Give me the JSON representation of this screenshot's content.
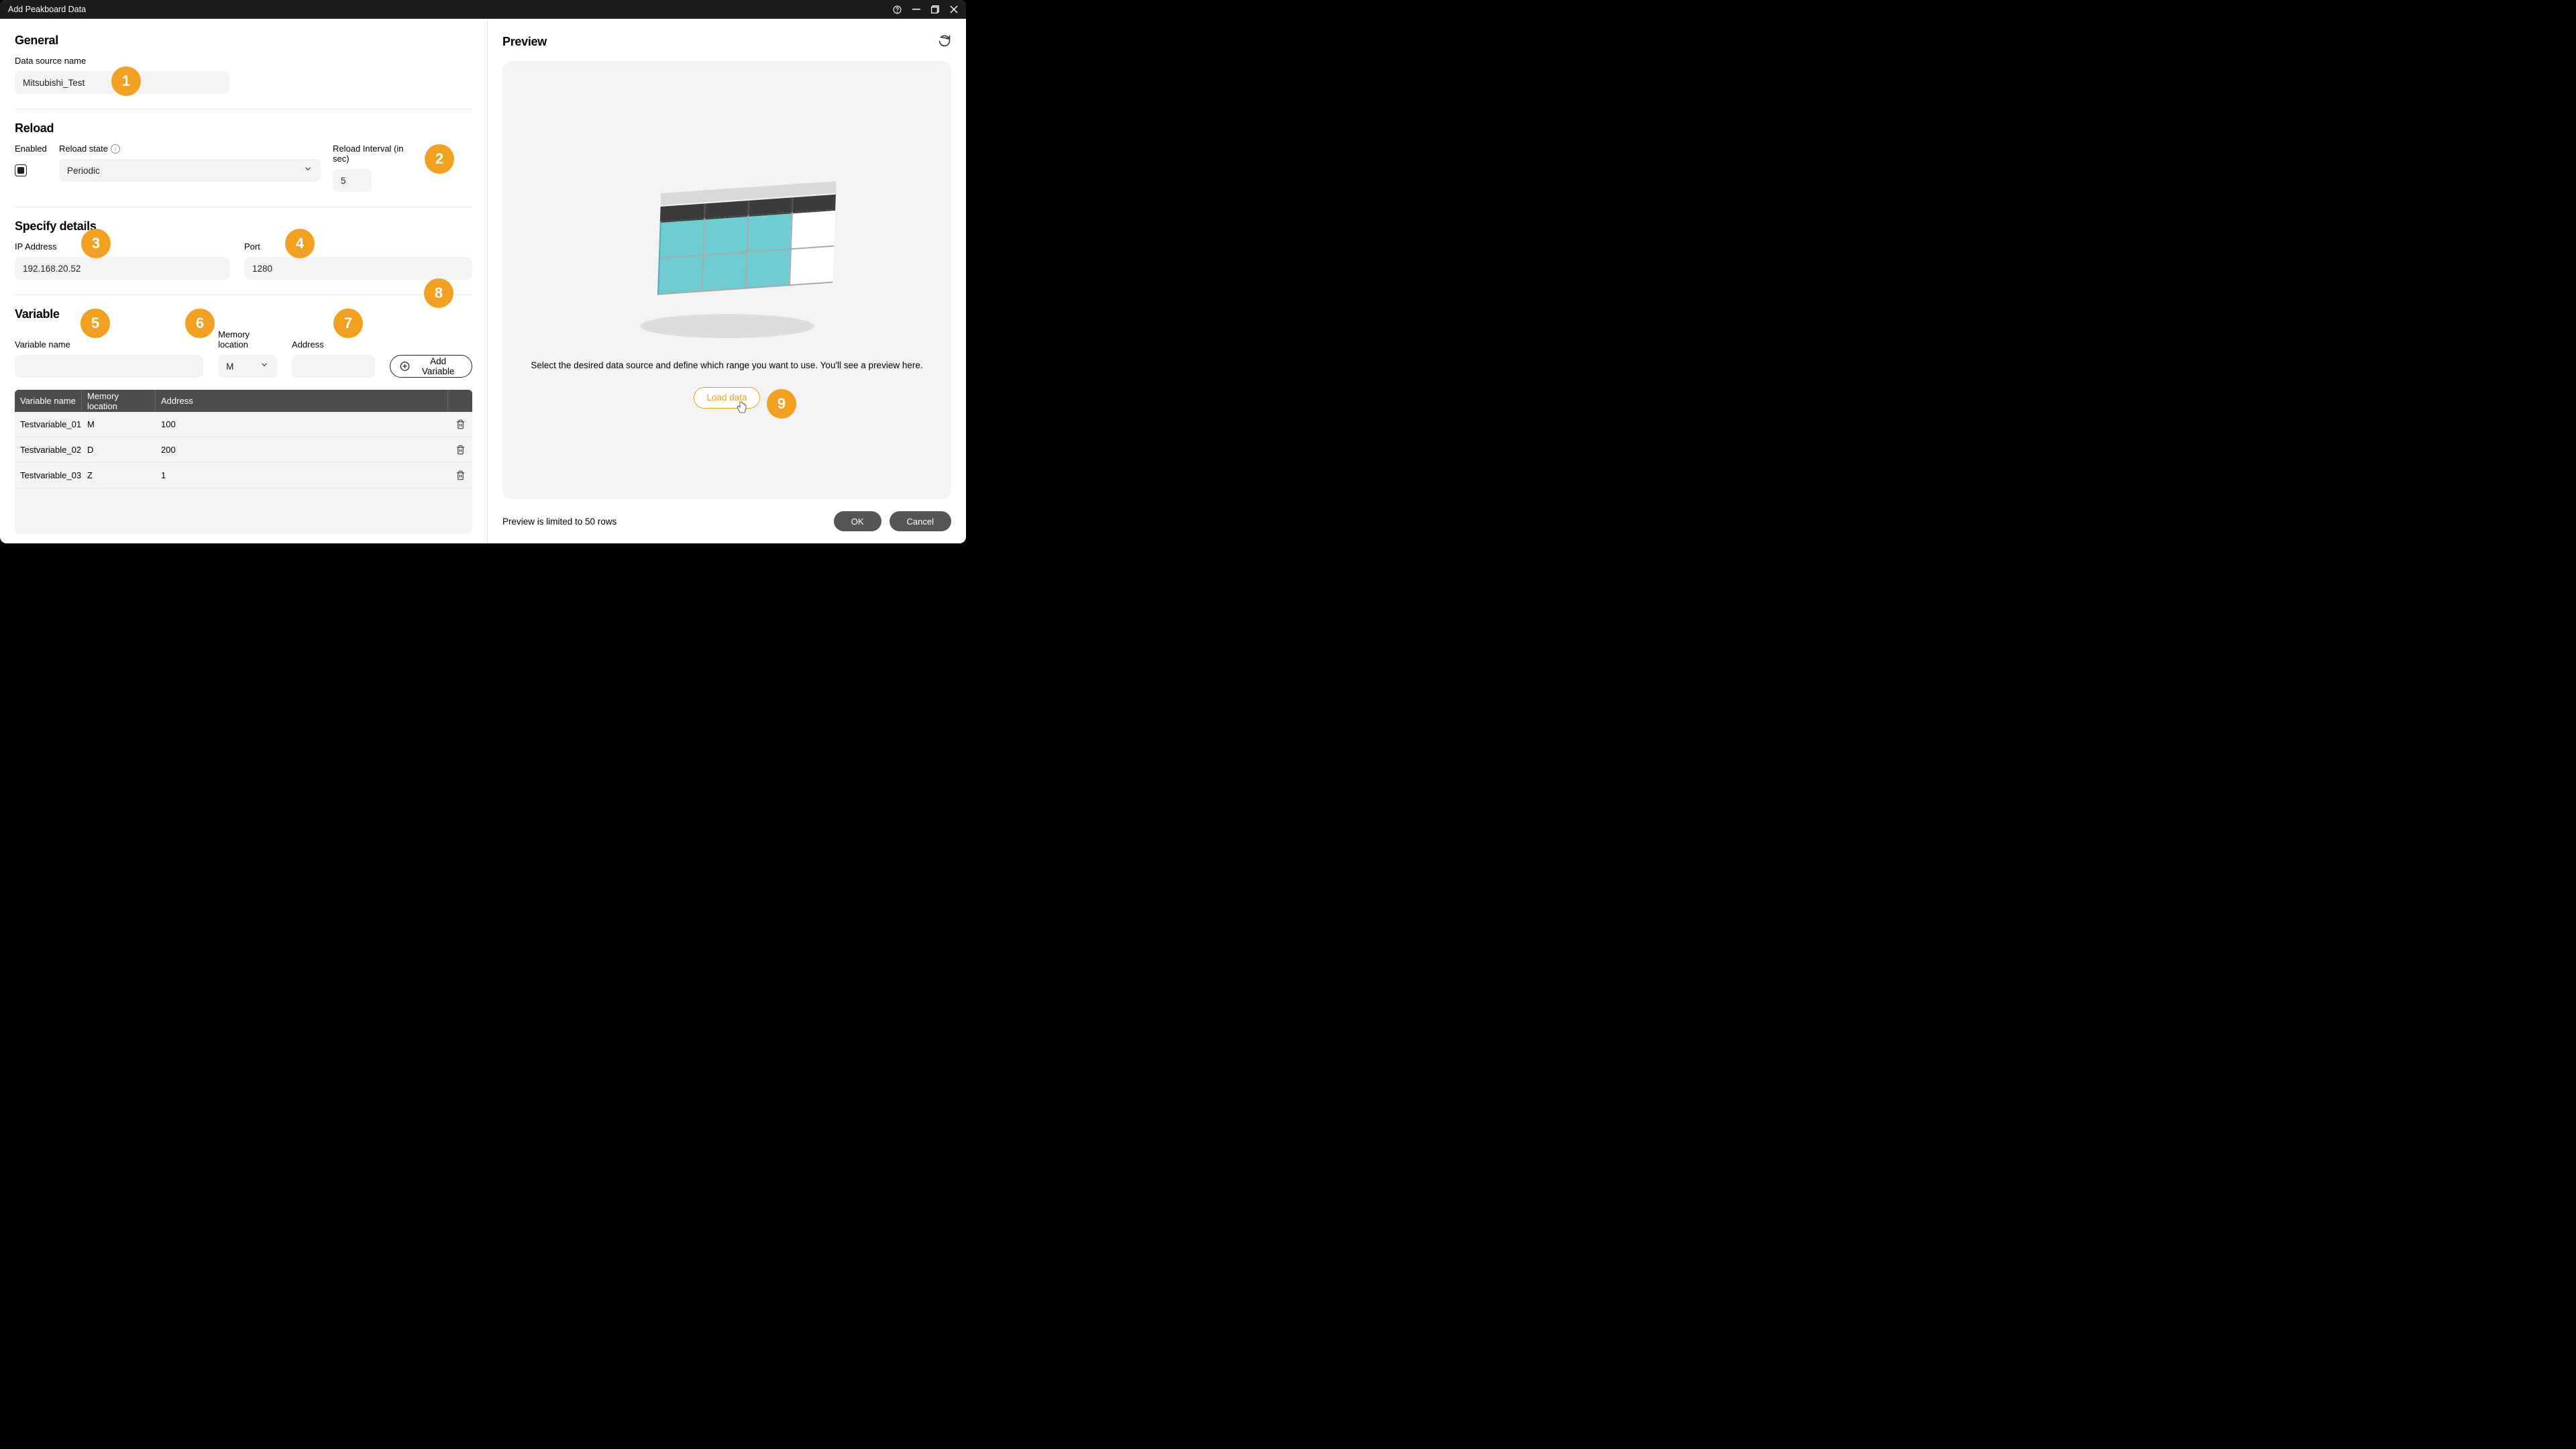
{
  "window": {
    "title": "Add Peakboard Data"
  },
  "general": {
    "title": "General",
    "dataSourceNameLabel": "Data source name",
    "dataSourceName": "Mitsubishi_Test"
  },
  "reload": {
    "title": "Reload",
    "enabledLabel": "Enabled",
    "enabled": true,
    "stateLabel": "Reload state",
    "state": "Periodic",
    "intervalLabel": "Reload Interval (in sec)",
    "interval": "5"
  },
  "details": {
    "title": "Specify details",
    "ipLabel": "IP Address",
    "ip": "192.168.20.52",
    "portLabel": "Port",
    "port": "1280"
  },
  "variable": {
    "title": "Variable",
    "nameLabel": "Variable name",
    "name": "",
    "memoryLabel": "Memory location",
    "memory": "M",
    "addressLabel": "Address",
    "address": "",
    "addBtn": "Add Variable",
    "columns": {
      "name": "Variable name",
      "memory": "Memory location",
      "address": "Address"
    },
    "rows": [
      {
        "name": "Testvariable_01",
        "memory": "M",
        "address": "100"
      },
      {
        "name": "Testvariable_02",
        "memory": "D",
        "address": "200"
      },
      {
        "name": "Testvariable_03",
        "memory": "Z",
        "address": "1"
      }
    ]
  },
  "preview": {
    "title": "Preview",
    "hint": "Select the desired data source and define which range you want to use. You'll see a preview here.",
    "loadBtn": "Load data",
    "limit": "Preview is limited to 50 rows",
    "ok": "OK",
    "cancel": "Cancel"
  },
  "callouts": [
    "1",
    "2",
    "3",
    "4",
    "5",
    "6",
    "7",
    "8",
    "9"
  ]
}
